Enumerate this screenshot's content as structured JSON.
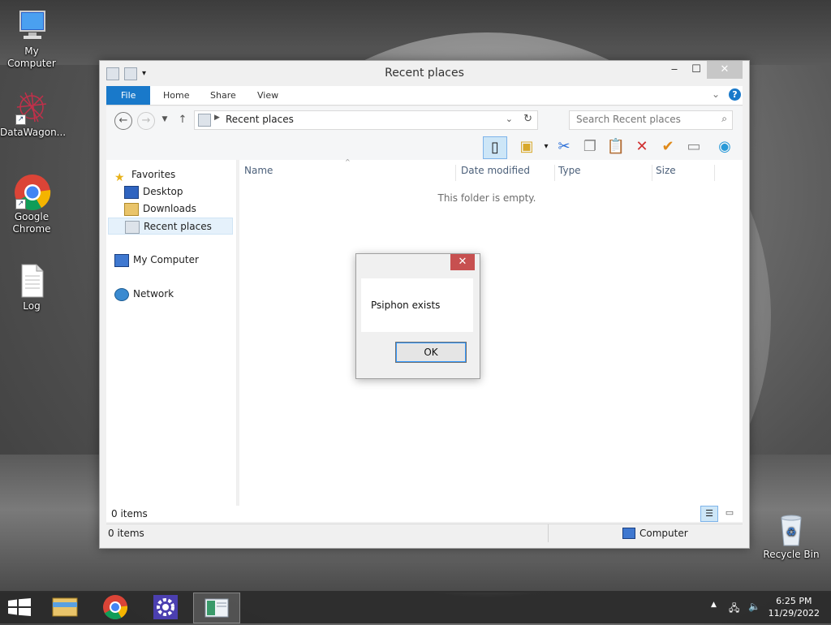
{
  "desktop": {
    "icons": [
      {
        "label": "My Computer"
      },
      {
        "label": "DataWagon..."
      },
      {
        "label": "Google Chrome"
      },
      {
        "label": "Log"
      },
      {
        "label": "Recycle Bin"
      }
    ]
  },
  "window": {
    "title": "Recent places",
    "ribbon_tabs": [
      "File",
      "Home",
      "Share",
      "View"
    ],
    "address": "Recent places",
    "search_placeholder": "Search Recent places",
    "columns": [
      "Name",
      "Date modified",
      "Type",
      "Size"
    ],
    "empty_text": "This folder is empty.",
    "nav": {
      "favorites": "Favorites",
      "desktop": "Desktop",
      "downloads": "Downloads",
      "recent": "Recent places",
      "my_computer": "My Computer",
      "network": "Network"
    },
    "item_count": "0 items",
    "status_count": "0 items",
    "status_location": "Computer"
  },
  "dialog": {
    "message": "Psiphon exists",
    "ok_label": "OK",
    "close_glyph": "✕"
  },
  "taskbar": {
    "time": "6:25 PM",
    "date": "11/29/2022"
  },
  "colors": {
    "accent": "#1979ca",
    "close_red": "#c75050",
    "selection": "#cde6f7"
  }
}
